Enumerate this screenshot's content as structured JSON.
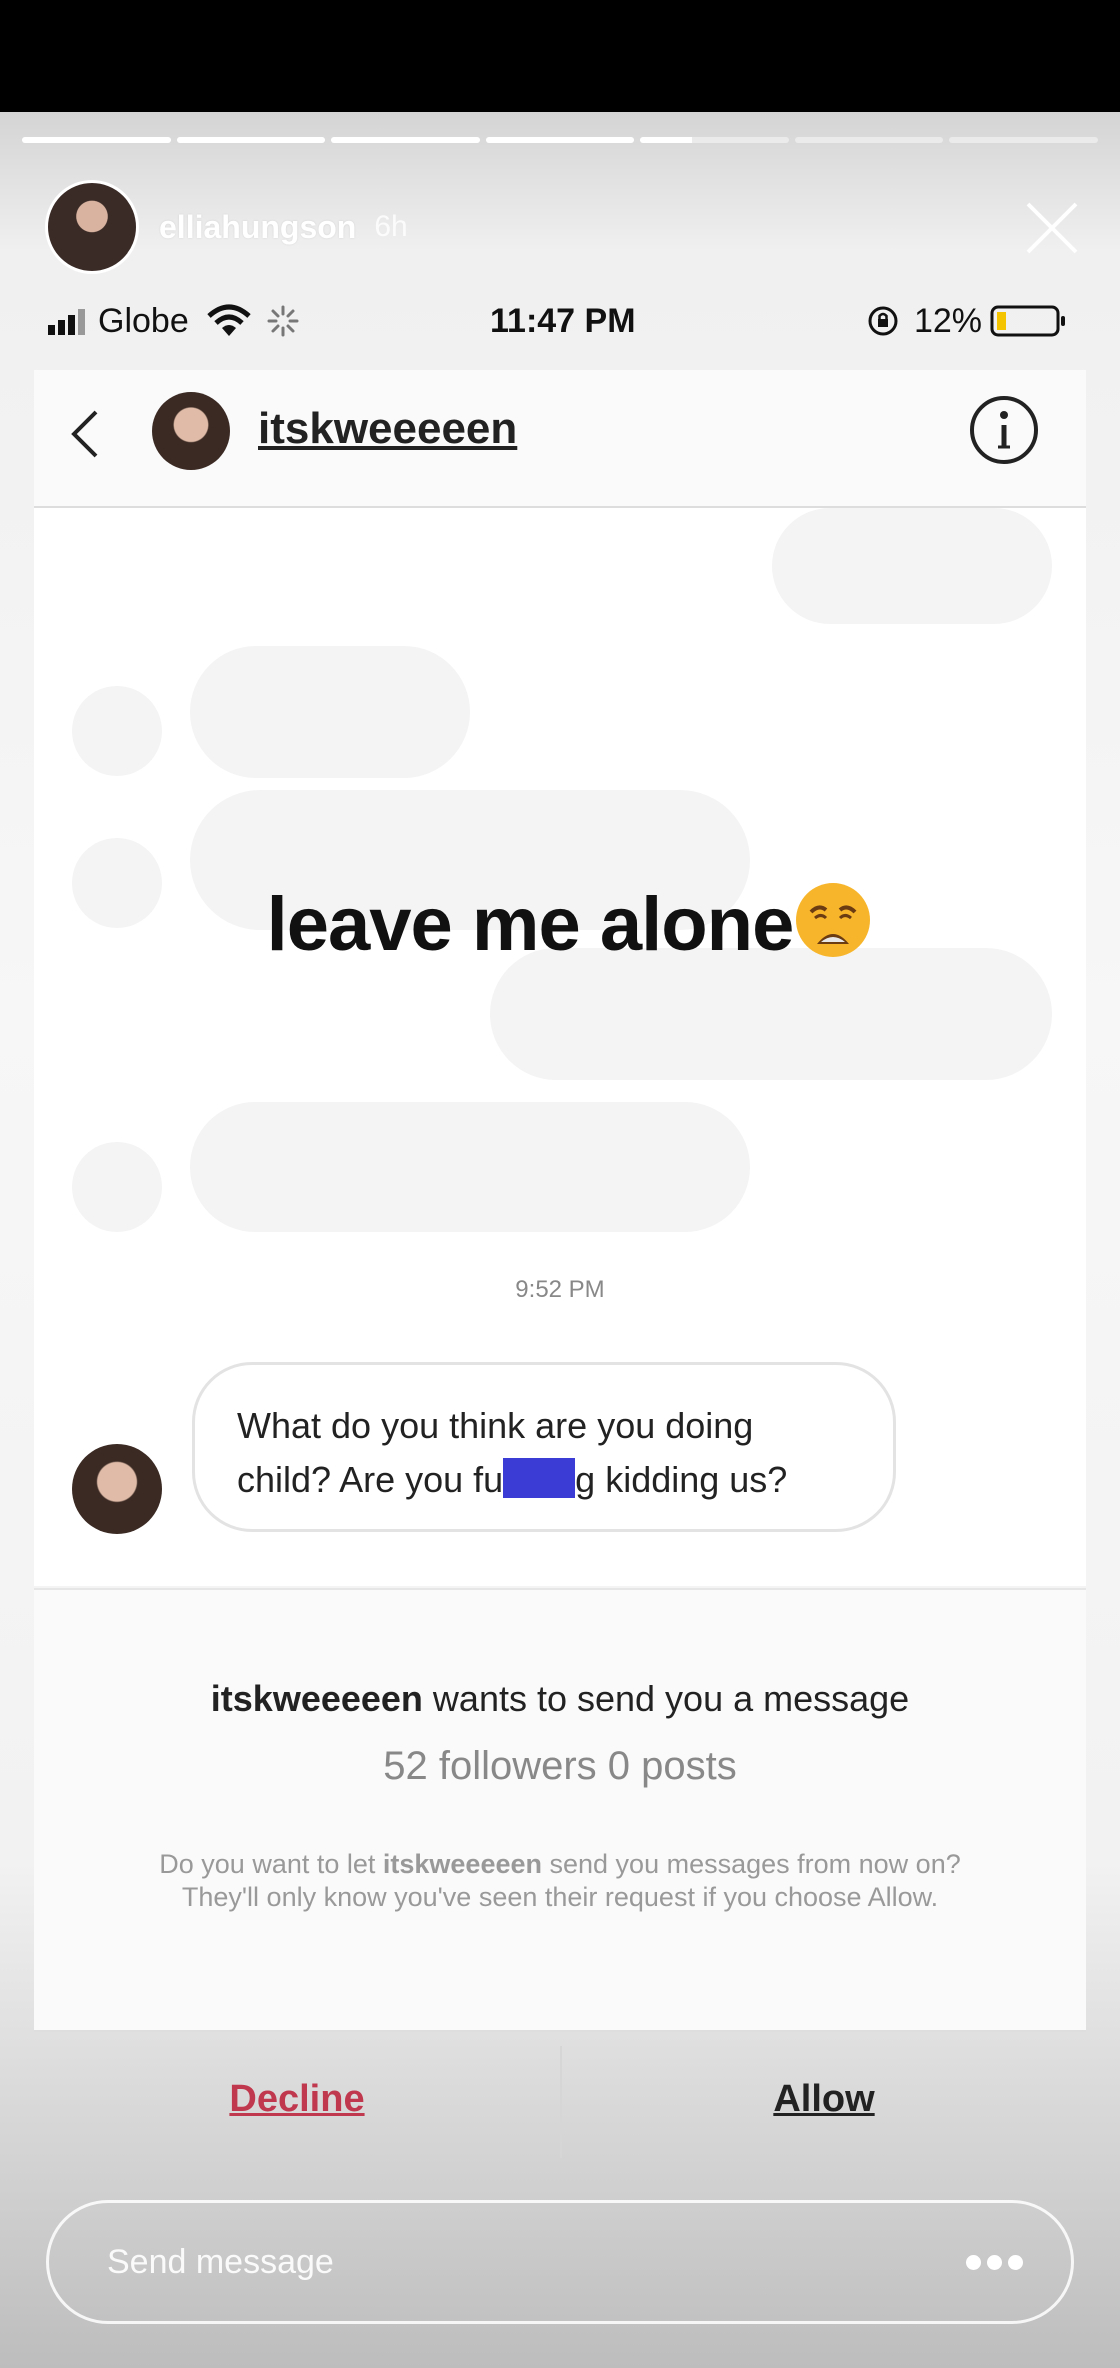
{
  "story": {
    "username": "elliahungson",
    "time_ago": "6h",
    "segments": [
      1,
      1,
      1,
      1,
      0.35,
      0,
      0
    ]
  },
  "status_bar": {
    "carrier": "Globe",
    "time": "11:47 PM",
    "battery": "12%"
  },
  "dm_header": {
    "username": "itskweeeeen"
  },
  "overlay_text": "leave me alone",
  "chat": {
    "timestamp": "9:52 PM",
    "message_line1": "What do you think are you doing",
    "message_line2_pre": "child? Are you fu",
    "message_line2_post": "g kidding us?"
  },
  "request": {
    "username": "itskweeeeen",
    "title_rest": " wants to send you a message",
    "stats": "52 followers 0 posts",
    "desc_pre": "Do you want to let ",
    "desc_user": "itskweeeeen",
    "desc_post": " send you messages from now on? They'll only know you've seen their request if you choose Allow."
  },
  "actions": {
    "decline": "Decline",
    "allow": "Allow"
  },
  "composer": {
    "placeholder": "Send message"
  },
  "colors": {
    "decline": "#c0384e",
    "censor": "#3b3bd6"
  }
}
